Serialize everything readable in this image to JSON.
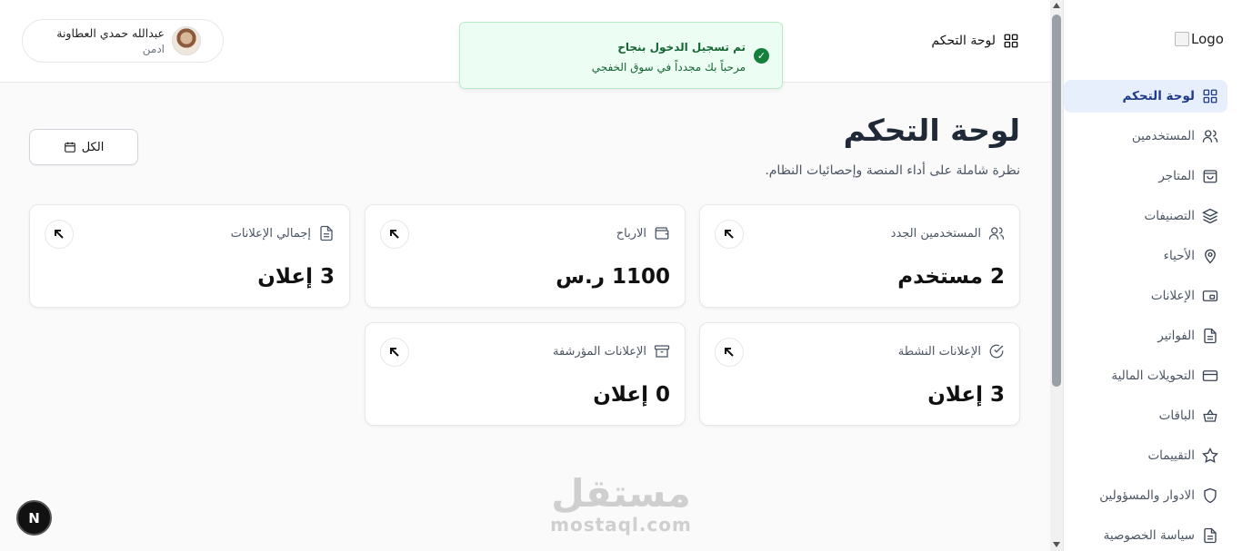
{
  "header": {
    "title": "لوحة التحكم",
    "user": {
      "name": "عبدالله حمدي العطاونة",
      "role": "ادمن"
    }
  },
  "toast": {
    "title": "تم تسجيل الدخول بنجاح",
    "message": "مرحباً بك مجدداً في سوق الخفجي"
  },
  "sidebar": {
    "logo": "Logo",
    "items": [
      {
        "label": "لوحة التحكم",
        "icon": "grid-icon",
        "active": true
      },
      {
        "label": "المستخدمين",
        "icon": "users-icon"
      },
      {
        "label": "المتاجر",
        "icon": "shopping-bag-icon"
      },
      {
        "label": "التصنيفات",
        "icon": "layers-icon"
      },
      {
        "label": "الأحياء",
        "icon": "map-pin-icon"
      },
      {
        "label": "الإعلانات",
        "icon": "ad-icon"
      },
      {
        "label": "الفواتير",
        "icon": "file-text-icon"
      },
      {
        "label": "التحويلات المالية",
        "icon": "credit-card-icon"
      },
      {
        "label": "الباقات",
        "icon": "basket-icon"
      },
      {
        "label": "التقييمات",
        "icon": "star-icon"
      },
      {
        "label": "الادوار والمسؤولين",
        "icon": "shield-icon"
      },
      {
        "label": "سياسة الخصوصية",
        "icon": "document-icon"
      }
    ]
  },
  "main": {
    "title": "لوحة التحكم",
    "subtitle": "نظرة شاملة على أداء المنصة وإحصائيات النظام.",
    "filter_label": "الكل",
    "cards": [
      {
        "label": "المستخدمين الجدد",
        "value": "2 مستخدم",
        "icon": "users-icon"
      },
      {
        "label": "الارباح",
        "value": "1100 ر.س",
        "icon": "wallet-icon"
      },
      {
        "label": "إجمالي الإعلانات",
        "value": "3 إعلان",
        "icon": "file-icon"
      },
      {
        "label": "الإعلانات النشطة",
        "value": "3 إعلان",
        "icon": "check-circle-icon"
      },
      {
        "label": "الإعلانات المؤرشفة",
        "value": "0 إعلان",
        "icon": "archive-icon"
      }
    ]
  },
  "badge": "N",
  "watermark": {
    "arabic": "مستقل",
    "latin": "mostaql.com"
  },
  "colors": {
    "accent": "#1f3a8a",
    "active_bg": "#e8effc",
    "toast_bg": "#ecfdf3",
    "toast_text": "#166534"
  }
}
